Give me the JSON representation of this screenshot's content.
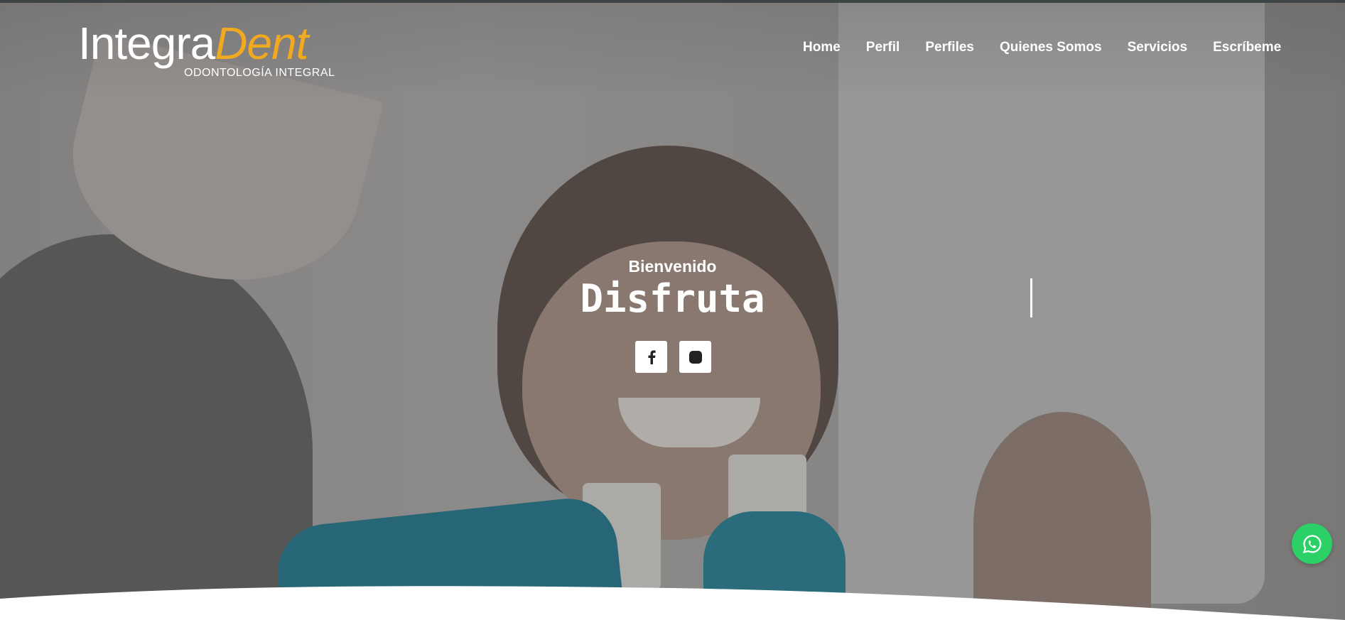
{
  "brand": {
    "name_part1": "Integra",
    "name_part2": "Dent",
    "tagline": "ODONTOLOGÍA INTEGRAL",
    "accent_color": "#f1a91f"
  },
  "nav": {
    "items": [
      {
        "label": "Home"
      },
      {
        "label": "Perfil"
      },
      {
        "label": "Perfiles"
      },
      {
        "label": "Quienes Somos"
      },
      {
        "label": "Servicios"
      },
      {
        "label": "Escríbeme"
      }
    ]
  },
  "hero": {
    "greeting": "Bienvenido",
    "headline": "Disfruta",
    "social": [
      {
        "icon": "facebook-icon"
      },
      {
        "icon": "instagram-icon"
      }
    ]
  },
  "whatsapp": {
    "icon": "whatsapp-icon",
    "color": "#2bd167"
  }
}
